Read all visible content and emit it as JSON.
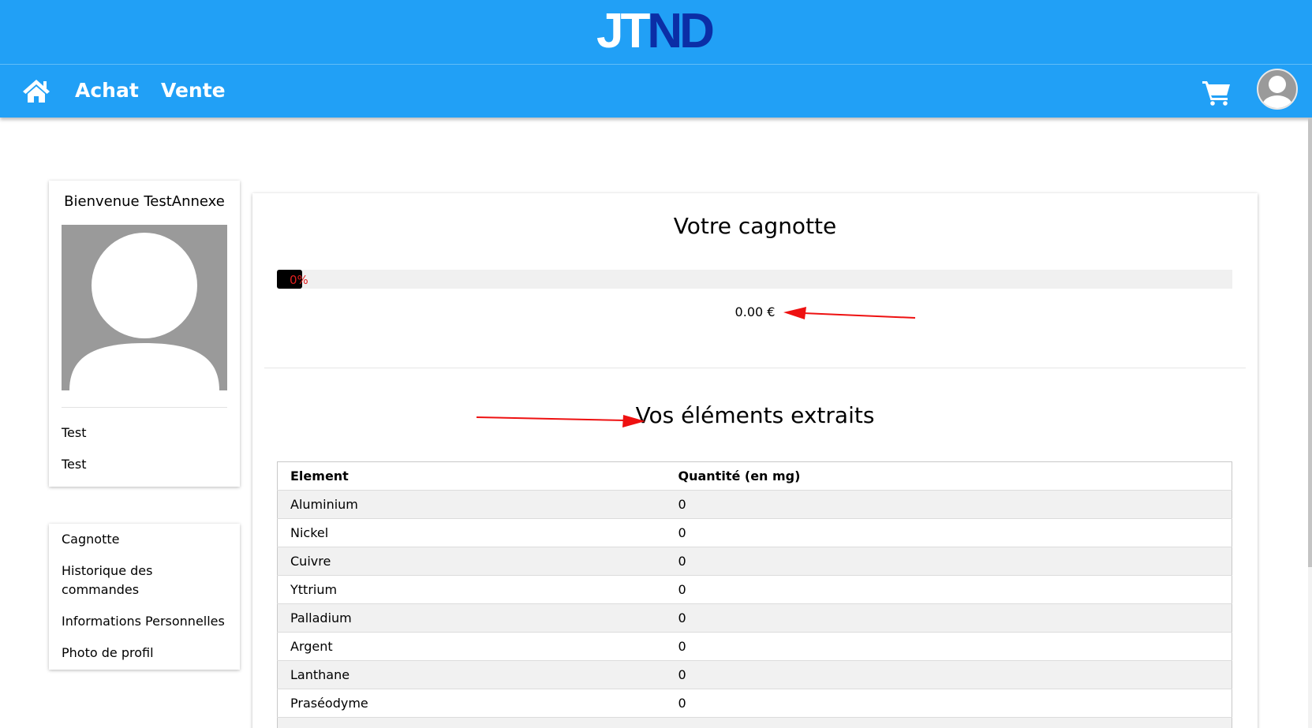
{
  "logo": {
    "part1": "JT",
    "part2": "ND"
  },
  "nav": {
    "icons": {
      "home": "home-icon",
      "cart": "cart-icon",
      "account": "user-avatar-icon"
    },
    "links": [
      "Achat",
      "Vente"
    ]
  },
  "profile": {
    "welcome": "Bienvenue TestAnnexe",
    "lines": [
      "Test",
      "Test"
    ]
  },
  "menu": {
    "items": [
      "Cagnotte",
      "Historique des commandes",
      "Informations Personnelles",
      "Photo de profil"
    ]
  },
  "main": {
    "title": "Votre cagnotte",
    "progress": {
      "percent": 0,
      "label": "0%"
    },
    "amount": "0.00 €",
    "section_title": "Vos éléments extraits",
    "table": {
      "headers": [
        "Element",
        "Quantité (en mg)"
      ],
      "rows": [
        [
          "Aluminium",
          "0"
        ],
        [
          "Nickel",
          "0"
        ],
        [
          "Cuivre",
          "0"
        ],
        [
          "Yttrium",
          "0"
        ],
        [
          "Palladium",
          "0"
        ],
        [
          "Argent",
          "0"
        ],
        [
          "Lanthane",
          "0"
        ],
        [
          "Praséodyme",
          "0"
        ]
      ]
    }
  },
  "colors": {
    "header_bg": "#21a0f6",
    "logo_dark": "#0b2ea6",
    "annotation_arrow": "#ee1111",
    "progress_label": "#e02020"
  }
}
